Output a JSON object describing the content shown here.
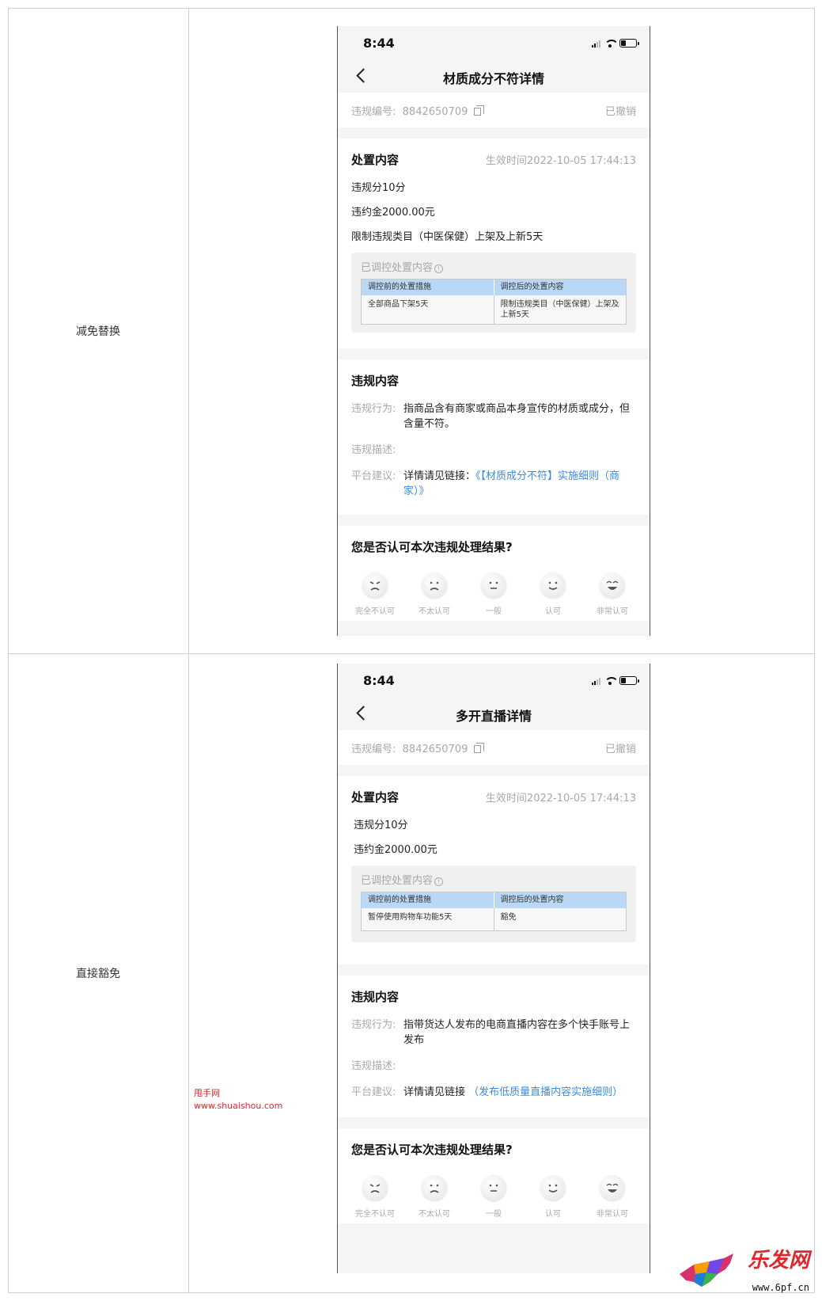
{
  "rows": [
    {
      "label": "减免替换",
      "phone": {
        "status_time": "8:44",
        "nav_title": "材质成分不符详情",
        "violation_id_label": "违规编号:",
        "violation_id": "8842650709",
        "status": "已撤销",
        "penalty": {
          "title": "处置内容",
          "effective_time": "生效时间2022-10-05 17:44:13",
          "lines": [
            "违规分10分",
            "违约金2000.00元",
            "限制违规类目（中医保健）上架及上新5天"
          ],
          "adjusted_title": "已调控处置内容",
          "table_headers": [
            "调控前的处置措施",
            "调控后的处置内容"
          ],
          "table_row": [
            "全部商品下架5天",
            "限制违规类目（中医保健）上架及上新5天"
          ]
        },
        "violation": {
          "title": "违规内容",
          "behavior_label": "违规行为:",
          "behavior": "指商品含有商家或商品本身宣传的材质或成分，但含量不符。",
          "desc_label": "违规描述:",
          "desc": "",
          "advice_label": "平台建议:",
          "advice_prefix": "详情请见链接：",
          "advice_link": "《【材质成分不符】实施细则（商家）》"
        },
        "rating": {
          "title": "您是否认可本次违规处理结果?",
          "options": [
            "完全不认可",
            "不太认可",
            "一般",
            "认可",
            "非常认可"
          ]
        }
      }
    },
    {
      "label": "直接豁免",
      "phone": {
        "status_time": "8:44",
        "nav_title": "多开直播详情",
        "violation_id_label": "违规编号:",
        "violation_id": "8842650709",
        "status": "已撤销",
        "penalty": {
          "title": "处置内容",
          "effective_time": "生效时间2022-10-05 17:44:13",
          "lines": [
            "违规分10分",
            "违约金2000.00元"
          ],
          "adjusted_title": "已调控处置内容",
          "table_headers": [
            "调控前的处置措施",
            "调控后的处置内容"
          ],
          "table_row": [
            "暂停使用购物车功能5天",
            "豁免"
          ]
        },
        "violation": {
          "title": "违规内容",
          "behavior_label": "违规行为:",
          "behavior": "指带货达人发布的电商直播内容在多个快手账号上发布",
          "desc_label": "违规描述:",
          "desc": "",
          "advice_label": "平台建议:",
          "advice_prefix": "详情请见链接",
          "advice_link": "（发布低质量直播内容实施细则）"
        },
        "rating": {
          "title": "您是否认可本次违规处理结果?",
          "options": [
            "完全不认可",
            "不太认可",
            "一般",
            "认可",
            "非常认可"
          ]
        }
      }
    }
  ],
  "watermark": {
    "name": "甩手网",
    "url": "www.shuaishou.com"
  },
  "logo": {
    "text": "乐发网",
    "url": "www.6pf.cn"
  },
  "icons": {
    "back": "chevron-left-icon",
    "copy": "copy-icon",
    "info": "info-icon",
    "faces": [
      "angry-face-icon",
      "frown-face-icon",
      "neutral-face-icon",
      "smile-face-icon",
      "grin-face-icon"
    ]
  }
}
